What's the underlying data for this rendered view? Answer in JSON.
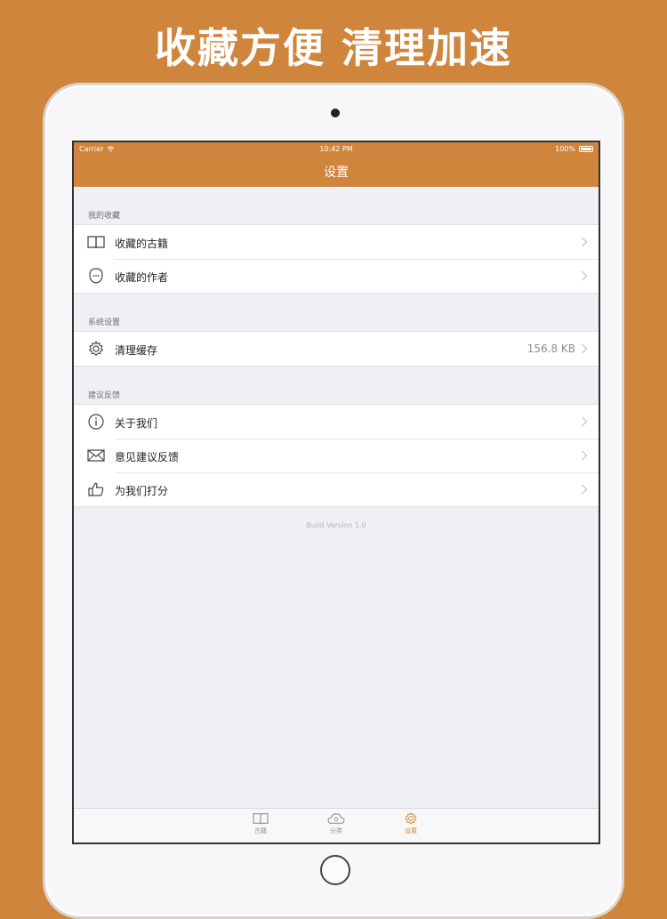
{
  "promo": {
    "title": "收藏方便 清理加速"
  },
  "status_bar": {
    "carrier": "Carrier",
    "time": "10:42 PM",
    "battery": "100%"
  },
  "nav": {
    "title": "设置"
  },
  "sections": [
    {
      "header": "我的收藏",
      "items": [
        {
          "label": "收藏的古籍",
          "icon": "book-icon"
        },
        {
          "label": "收藏的作者",
          "icon": "author-face-icon"
        }
      ]
    },
    {
      "header": "系统设置",
      "items": [
        {
          "label": "清理缓存",
          "icon": "gear-icon",
          "detail": "156.8 KB"
        }
      ]
    },
    {
      "header": "建议反馈",
      "items": [
        {
          "label": "关于我们",
          "icon": "info-icon"
        },
        {
          "label": "意见建议反馈",
          "icon": "mail-icon"
        },
        {
          "label": "为我们打分",
          "icon": "thumbs-up-icon"
        }
      ]
    }
  ],
  "footer": {
    "version": "Build Version 1.0"
  },
  "tabbar": {
    "tabs": [
      {
        "label": "古籍",
        "icon": "book-icon",
        "active": false
      },
      {
        "label": "分类",
        "icon": "cloud-icon",
        "active": false
      },
      {
        "label": "设置",
        "icon": "gear-icon",
        "active": true
      }
    ]
  },
  "colors": {
    "accent": "#cf853c",
    "background": "#eff0f4"
  }
}
